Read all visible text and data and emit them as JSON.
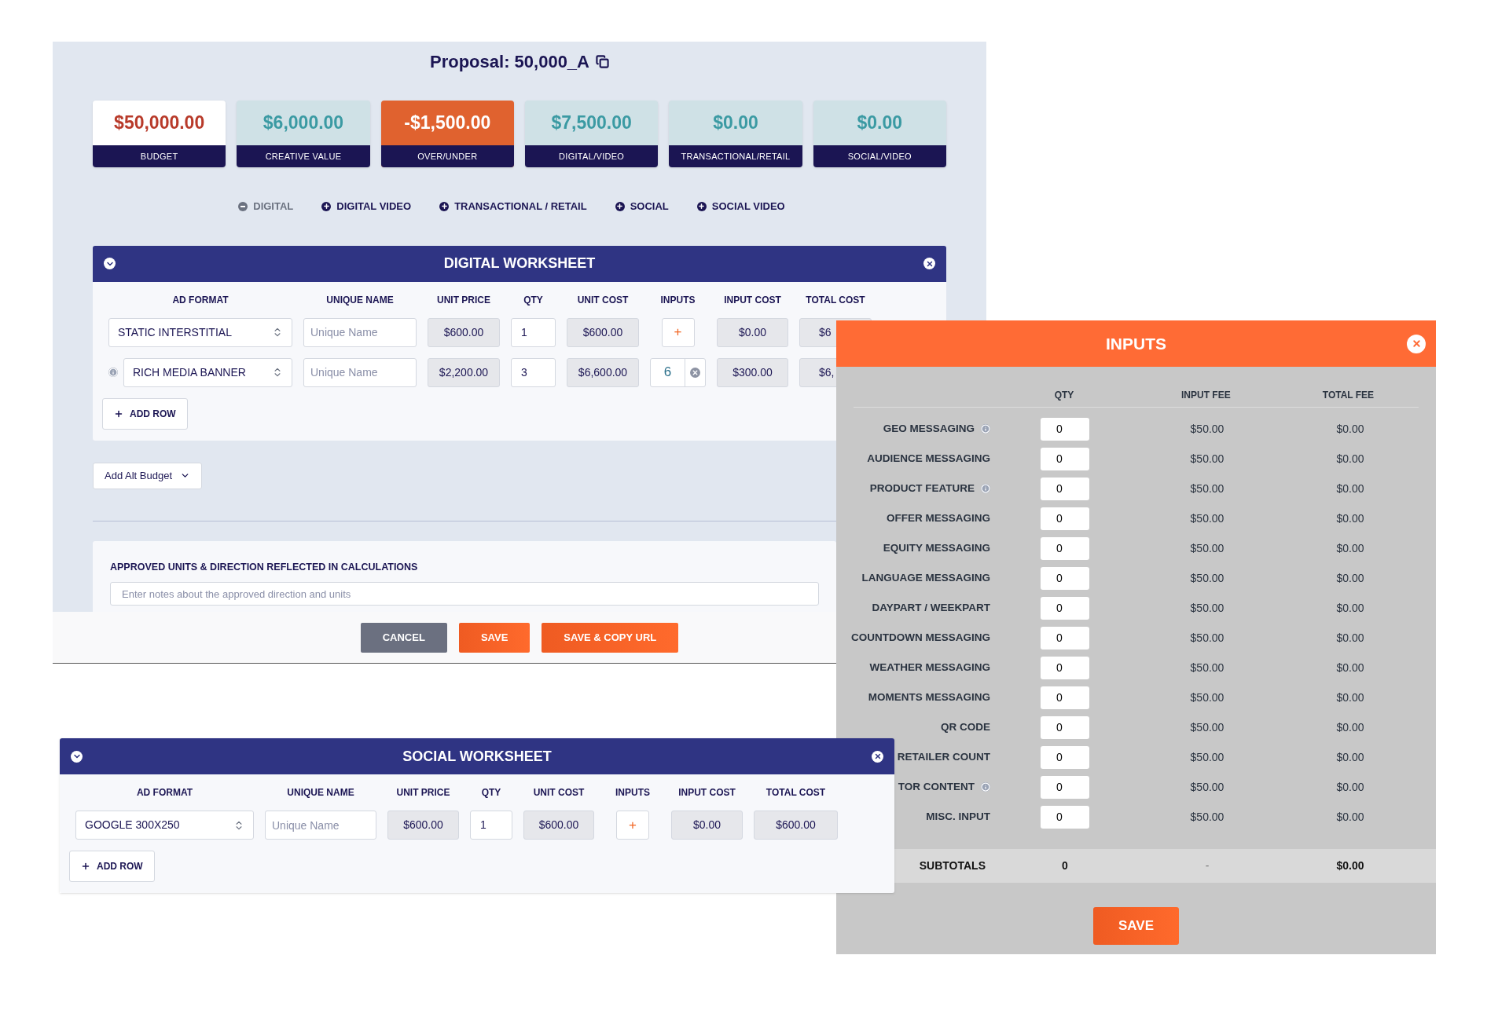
{
  "proposal": {
    "title": "Proposal: 50,000_A"
  },
  "summary": [
    {
      "value": "$50,000.00",
      "label": "BUDGET",
      "kind": "budget"
    },
    {
      "value": "$6,000.00",
      "label": "CREATIVE VALUE",
      "kind": "normal"
    },
    {
      "value": "-$1,500.00",
      "label": "OVER/UNDER",
      "kind": "alert"
    },
    {
      "value": "$7,500.00",
      "label": "DIGITAL/VIDEO",
      "kind": "normal"
    },
    {
      "value": "$0.00",
      "label": "TRANSACTIONAL/RETAIL",
      "kind": "normal"
    },
    {
      "value": "$0.00",
      "label": "SOCIAL/VIDEO",
      "kind": "normal"
    }
  ],
  "sections": [
    {
      "label": "DIGITAL",
      "added": true
    },
    {
      "label": "DIGITAL VIDEO",
      "added": false
    },
    {
      "label": "TRANSACTIONAL / RETAIL",
      "added": false
    },
    {
      "label": "SOCIAL",
      "added": false
    },
    {
      "label": "SOCIAL VIDEO",
      "added": false
    }
  ],
  "digital_worksheet": {
    "title": "DIGITAL WORKSHEET",
    "columns": [
      "AD FORMAT",
      "UNIQUE NAME",
      "UNIT PRICE",
      "QTY",
      "UNIT COST",
      "INPUTS",
      "INPUT COST",
      "TOTAL COST"
    ],
    "rows": [
      {
        "info": false,
        "ad_format": "STATIC INTERSTITIAL",
        "unique_name": {
          "placeholder": "Unique Name"
        },
        "unit_price": "$600.00",
        "qty": "1",
        "unit_cost": "$600.00",
        "inputs": {
          "kind": "add",
          "text": "+"
        },
        "input_cost": "$0.00",
        "total_cost": "$6"
      },
      {
        "info": true,
        "ad_format": "RICH MEDIA BANNER",
        "unique_name": {
          "placeholder": "Unique Name"
        },
        "unit_price": "$2,200.00",
        "qty": "3",
        "unit_cost": "$6,600.00",
        "inputs": {
          "kind": "count",
          "text": "6"
        },
        "input_cost": "$300.00",
        "total_cost": "$6,"
      }
    ],
    "add_row": "ADD ROW"
  },
  "alt_budget": {
    "label": "Add Alt Budget"
  },
  "notes": {
    "label": "APPROVED UNITS & DIRECTION REFLECTED IN CALCULATIONS",
    "placeholder": "Enter notes about the approved direction and units"
  },
  "footer_buttons": [
    {
      "label": "CANCEL",
      "kind": "secondary"
    },
    {
      "label": "SAVE",
      "kind": "primary"
    },
    {
      "label": "SAVE & COPY URL",
      "kind": "primary"
    }
  ],
  "inputs_dialog": {
    "title": "INPUTS",
    "columns": [
      "QTY",
      "INPUT FEE",
      "TOTAL FEE"
    ],
    "rows": [
      {
        "label": "GEO MESSAGING",
        "info": true,
        "qty": "0",
        "fee": "$50.00",
        "total": "$0.00"
      },
      {
        "label": "AUDIENCE MESSAGING",
        "info": false,
        "qty": "0",
        "fee": "$50.00",
        "total": "$0.00"
      },
      {
        "label": "PRODUCT FEATURE",
        "info": true,
        "qty": "0",
        "fee": "$50.00",
        "total": "$0.00"
      },
      {
        "label": "OFFER MESSAGING",
        "info": false,
        "qty": "0",
        "fee": "$50.00",
        "total": "$0.00"
      },
      {
        "label": "EQUITY MESSAGING",
        "info": false,
        "qty": "0",
        "fee": "$50.00",
        "total": "$0.00"
      },
      {
        "label": "LANGUAGE MESSAGING",
        "info": false,
        "qty": "0",
        "fee": "$50.00",
        "total": "$0.00"
      },
      {
        "label": "DAYPART / WEEKPART",
        "info": false,
        "qty": "0",
        "fee": "$50.00",
        "total": "$0.00"
      },
      {
        "label": "COUNTDOWN MESSAGING",
        "info": false,
        "qty": "0",
        "fee": "$50.00",
        "total": "$0.00"
      },
      {
        "label": "WEATHER MESSAGING",
        "info": false,
        "qty": "0",
        "fee": "$50.00",
        "total": "$0.00"
      },
      {
        "label": "MOMENTS MESSAGING",
        "info": false,
        "qty": "0",
        "fee": "$50.00",
        "total": "$0.00"
      },
      {
        "label": "QR CODE",
        "info": false,
        "qty": "0",
        "fee": "$50.00",
        "total": "$0.00"
      },
      {
        "label": "RETAILER COUNT",
        "info": false,
        "qty": "0",
        "fee": "$50.00",
        "total": "$0.00"
      },
      {
        "label": "TOR CONTENT",
        "info": true,
        "qty": "0",
        "fee": "$50.00",
        "total": "$0.00"
      },
      {
        "label": "MISC. INPUT",
        "info": false,
        "qty": "0",
        "fee": "$50.00",
        "total": "$0.00"
      }
    ],
    "subtotals": {
      "label": "SUBTOTALS",
      "qty": "0",
      "fee": "-",
      "total": "$0.00"
    },
    "save": "SAVE"
  },
  "social_worksheet": {
    "title": "SOCIAL WORKSHEET",
    "columns": [
      "AD FORMAT",
      "UNIQUE NAME",
      "UNIT PRICE",
      "QTY",
      "UNIT COST",
      "INPUTS",
      "INPUT COST",
      "TOTAL COST"
    ],
    "rows": [
      {
        "info": false,
        "ad_format": "GOOGLE 300X250",
        "unique_name": {
          "placeholder": "Unique Name"
        },
        "unit_price": "$600.00",
        "qty": "1",
        "unit_cost": "$600.00",
        "inputs": {
          "kind": "add",
          "text": "+"
        },
        "input_cost": "$0.00",
        "total_cost": "$600.00"
      }
    ],
    "add_row": "ADD ROW"
  }
}
